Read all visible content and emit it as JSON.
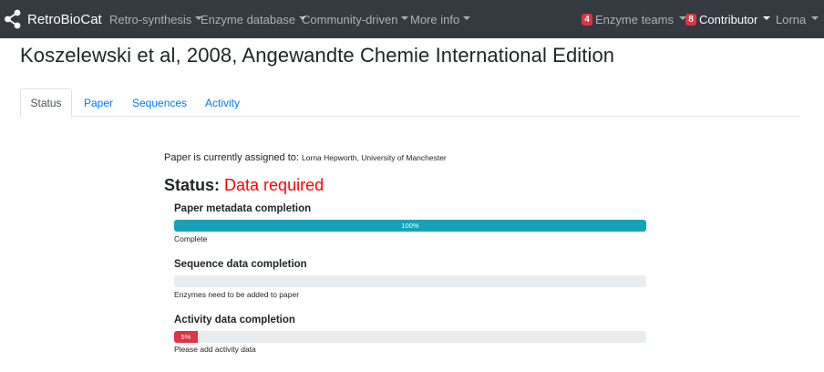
{
  "navbar": {
    "brand": "RetroBioCat",
    "menus": [
      {
        "label": "Retro-synthesis"
      },
      {
        "label": "Enzyme database"
      },
      {
        "label": "Community-driven"
      },
      {
        "label": "More info"
      }
    ],
    "enzyme_teams": {
      "count": "4",
      "label": "Enzyme teams"
    },
    "contributor": {
      "count": "8",
      "label": "Contributor"
    },
    "user": "Lorna",
    "colors": {
      "background": "#343a40",
      "badge": "#dc3545"
    }
  },
  "page": {
    "title": "Koszelewski et al, 2008, Angewandte Chemie International Edition"
  },
  "tabs": [
    {
      "label": "Status",
      "active": true
    },
    {
      "label": "Paper"
    },
    {
      "label": "Sequences"
    },
    {
      "label": "Activity"
    }
  ],
  "assignment": {
    "prefix": "Paper is currently assigned to:",
    "assignee": "Lorna Hepworth, University of Manchester"
  },
  "status": {
    "label": "Status:",
    "value": "Data required",
    "value_color": "#ff0000"
  },
  "progress": {
    "metadata": {
      "title": "Paper metadata completion",
      "percent": 100,
      "bar_label": "100%",
      "note": "Complete",
      "color": "#17a2b8"
    },
    "sequence": {
      "title": "Sequence data completion",
      "percent": 0,
      "bar_label": "",
      "note": "Enzymes need to be added to paper"
    },
    "activity": {
      "title": "Activity data completion",
      "percent": 5,
      "bar_label": "5%",
      "note": "Please add activity data",
      "color": "#dc3545"
    }
  }
}
